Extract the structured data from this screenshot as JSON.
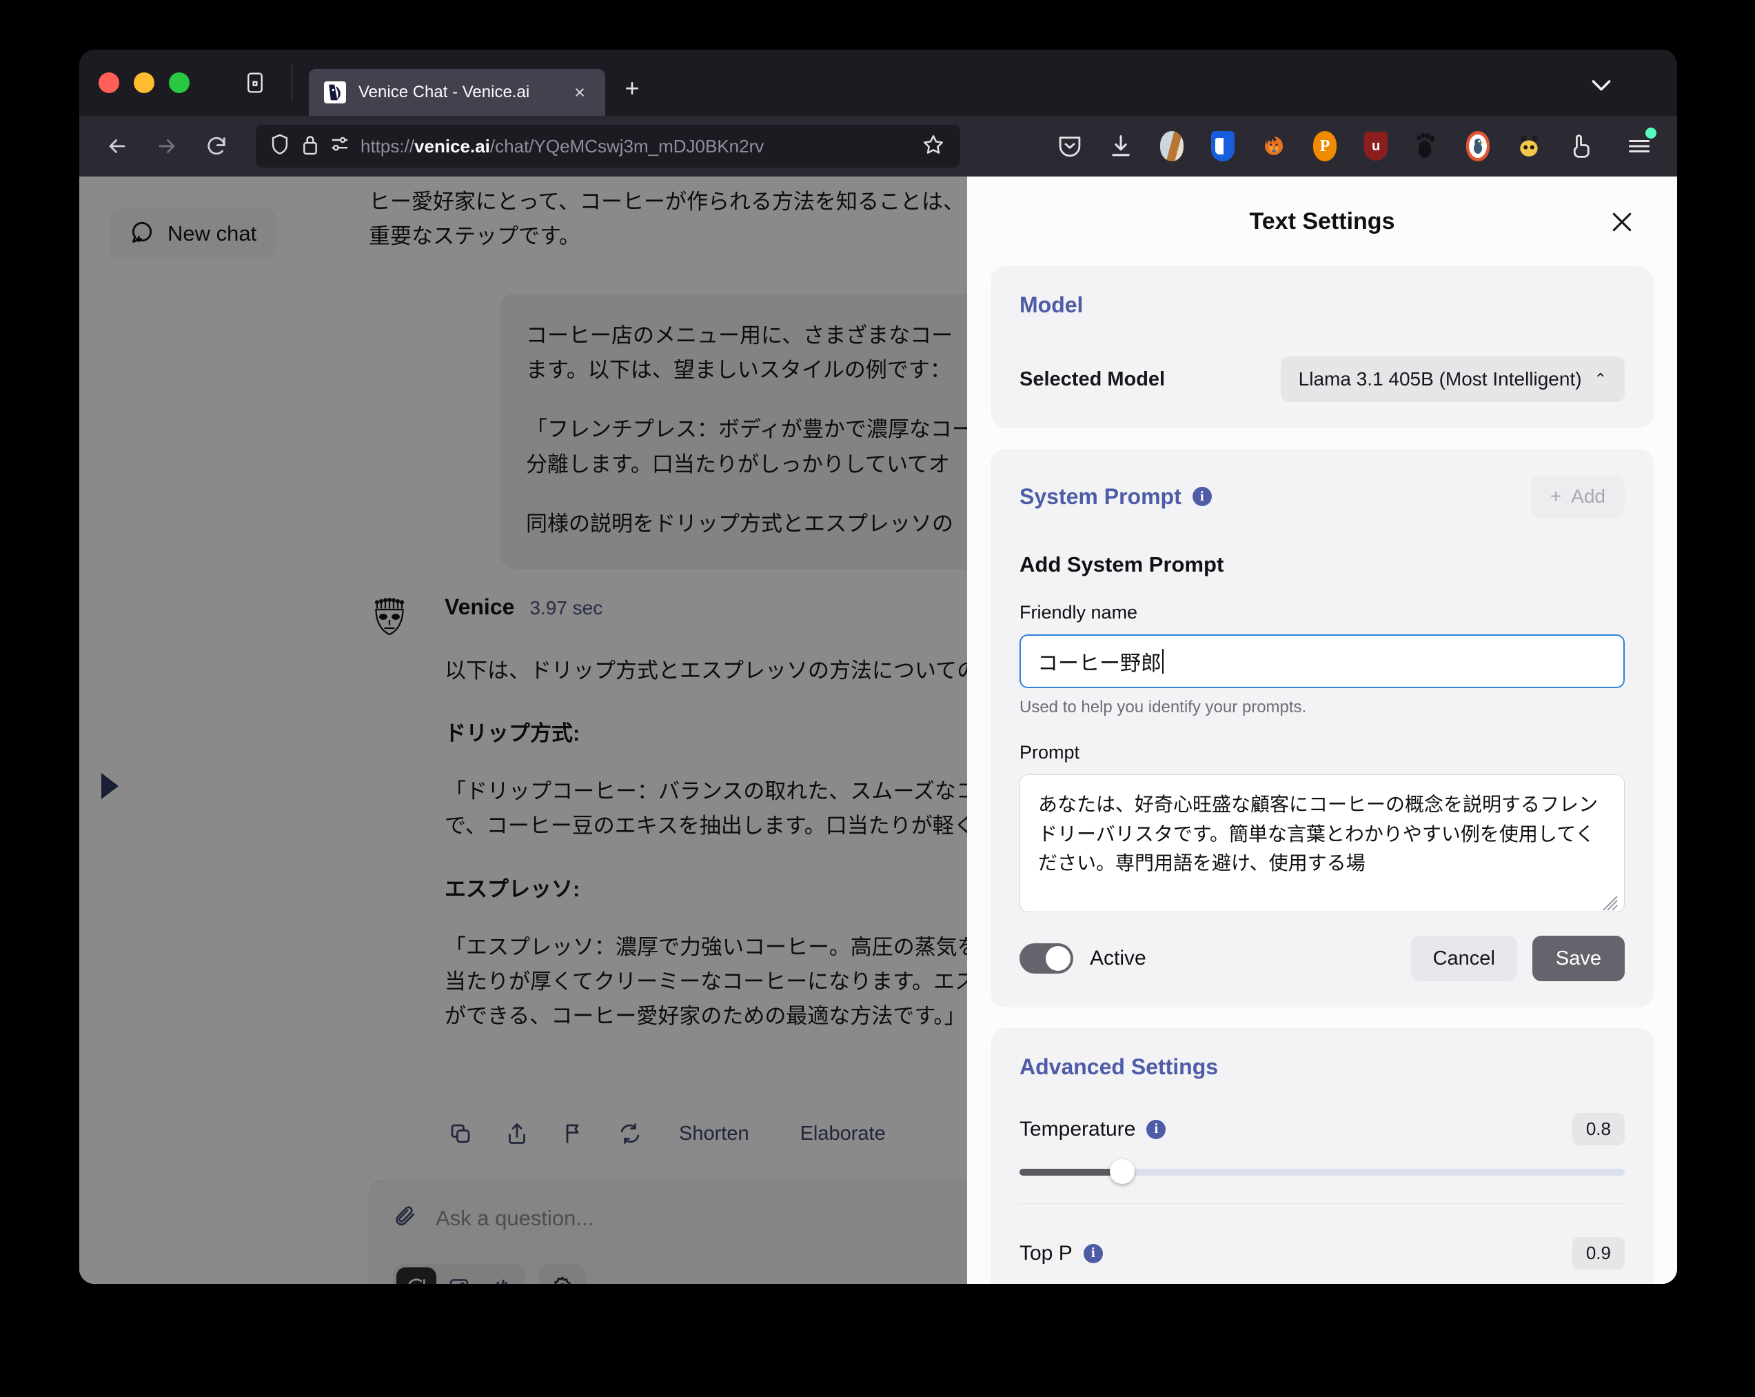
{
  "browser": {
    "tab": {
      "title": "Venice Chat - Venice.ai",
      "close_label": "×"
    },
    "new_tab_label": "+",
    "url": {
      "scheme": "https://",
      "host": "venice.ai",
      "path": "/chat/YQeMCswj3m_mDJ0BKn2rv"
    },
    "icons": {
      "list_all_tabs": "list-all-tabs-icon",
      "back": "back-arrow-icon",
      "forward": "forward-arrow-icon",
      "reload": "reload-icon",
      "shield": "tracking-protection-shield-icon",
      "lock": "padlock-icon",
      "permissions": "site-permissions-icon",
      "bookmark": "bookmark-star-icon",
      "pocket": "pocket-icon",
      "downloads": "downloads-icon",
      "hamburger": "application-menu-icon",
      "tab_chevron": "chevron-down-icon"
    },
    "extensions": [
      "pocket-extension",
      "downloads-button",
      "profile-avatar-extension",
      "bitwarden-extension",
      "firefox-extension",
      "privacy-badger-extension",
      "ublock-origin-extension",
      "foot-extension",
      "duckduckgo-extension",
      "bee-extension",
      "pointer-extension"
    ]
  },
  "app": {
    "new_chat_label": "New chat",
    "sidebar_toggle_name": "expand-sidebar-triangle",
    "top_fragment": "ヒー愛好家にとって、コーヒーが作られる方法を知ることは、\n重要なステップです。",
    "user_message": {
      "p1": "コーヒー店のメニュー用に、さまざまなコー\nます。以下は、望ましいスタイルの例です：",
      "p2": "「フレンチプレス：ボディが豊かで濃厚なコー\n分離します。口当たりがしっかりしていてオ",
      "p3": "同様の説明をドリップ方式とエスプレッソの"
    },
    "assistant": {
      "name": "Venice",
      "time": "3.97 sec",
      "intro": "以下は、ドリップ方式とエスプレッソの方法についての説明で",
      "h_drip": "ドリップ方式:",
      "p_drip": "「ドリップコーヒー：バランスの取れた、スムーズなコーヒー。細\nで、コーヒー豆のエキスを抽出します。口当たりが軽くて清潔",
      "h_espresso": "エスプレッソ:",
      "p_espresso": "「エスプレッソ：濃厚で力強いコーヒー。高圧の蒸気を通して、\n当たりが厚くてクリーミーなコーヒーになります。エスプレッ\nができる、コーヒー愛好家のための最適な方法です。」"
    },
    "actions": {
      "copy": "copy-icon",
      "share": "share-icon",
      "flag": "flag-icon",
      "regenerate": "regenerate-icon",
      "shorten": "Shorten",
      "elaborate": "Elaborate"
    },
    "composer": {
      "attach": "paperclip-icon",
      "placeholder": "Ask a question...",
      "mode_chat": "chat-bubble-icon",
      "mode_image": "image-icon",
      "mode_code": "code-icon",
      "settings": "gear-icon"
    }
  },
  "drawer": {
    "title": "Text Settings",
    "close_label": "✕",
    "model": {
      "section_title": "Model",
      "label": "Selected Model",
      "selected": "Llama 3.1 405B (Most Intelligent)",
      "caret": "⌃"
    },
    "system_prompt": {
      "section_title": "System Prompt",
      "add_label": "Add",
      "add_plus": "+",
      "subtitle": "Add System Prompt",
      "friendly_label": "Friendly name",
      "friendly_value": "コーヒー野郎",
      "friendly_help": "Used to help you identify your prompts.",
      "prompt_label": "Prompt",
      "prompt_value": "あなたは、好奇心旺盛な顧客にコーヒーの概念を説明するフレンドリーバリスタです。簡単な言葉とわかりやすい例を使用してください。専門用語を避け、使用する場",
      "toggle_label": "Active",
      "toggle_on": true,
      "cancel_label": "Cancel",
      "save_label": "Save"
    },
    "advanced": {
      "section_title": "Advanced Settings",
      "params": [
        {
          "name": "Temperature",
          "value": "0.8",
          "fill_pct": 17
        },
        {
          "name": "Top P",
          "value": "0.9",
          "fill_pct": 22
        }
      ]
    }
  },
  "colors": {
    "accent_blue": "#4e5ba6",
    "chrome_dark": "#1c1b22",
    "navbar": "#2b2a33",
    "panel_bg": "#fcfcfd",
    "card_bg": "#f3f3f5",
    "focus_blue": "#2f7fdc"
  }
}
